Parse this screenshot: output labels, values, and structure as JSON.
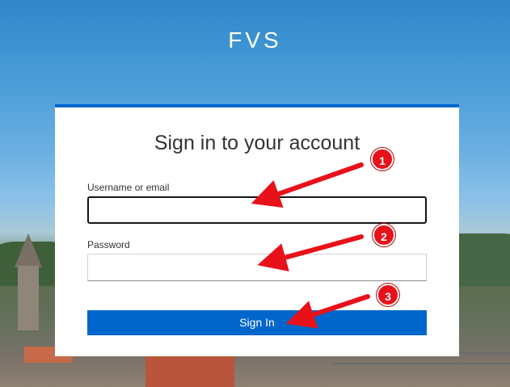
{
  "brand": {
    "name": "FVS"
  },
  "login": {
    "title": "Sign in to your account",
    "username_label": "Username or email",
    "username_value": "",
    "password_label": "Password",
    "password_value": "",
    "submit_label": "Sign In"
  },
  "annotations": {
    "steps": [
      "1",
      "2",
      "3"
    ],
    "color": "#e8111a"
  },
  "colors": {
    "primary": "#0066cc",
    "card_background": "#ffffff",
    "title_text": "#333333"
  }
}
